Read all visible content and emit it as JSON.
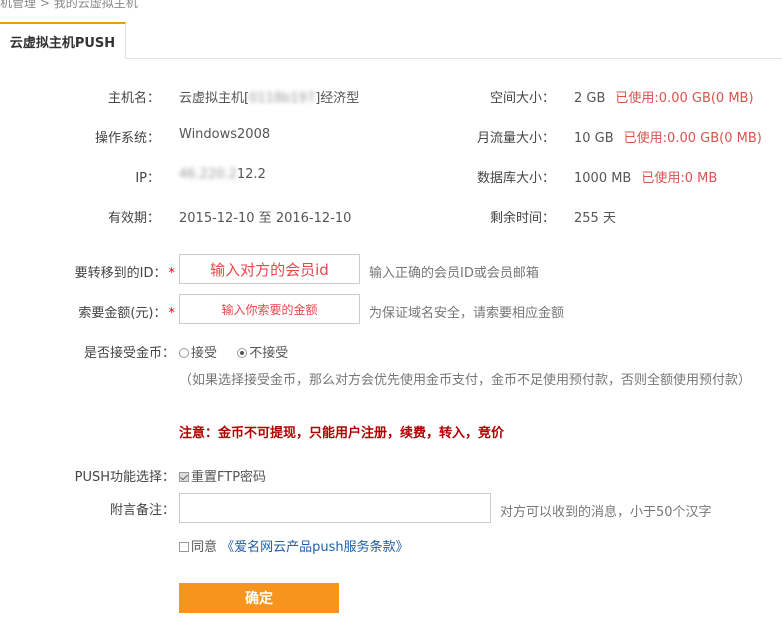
{
  "breadcrumb": {
    "parent": "机管理",
    "separator": ">",
    "current": "我的云虚拟主机"
  },
  "tab": {
    "label": "云虚拟主机PUSH"
  },
  "info": {
    "host_name_label": "主机名：",
    "host_name_prefix": "云虚拟主机[",
    "host_name_masked": "0118b197",
    "host_name_suffix": "]经济型",
    "os_label": "操作系统：",
    "os_value": "Windows2008",
    "ip_label": "IP：",
    "ip_masked": "46.220.2",
    "ip_suffix": "12.2",
    "validity_label": "有效期：",
    "validity_value": "2015-12-10 至 2016-12-10",
    "space_label": "空间大小：",
    "space_value": "2 GB",
    "space_used": "已使用:0.00 GB(0 MB)",
    "traffic_label": "月流量大小：",
    "traffic_value": "10 GB",
    "traffic_used": "已使用:0.00 GB(0 MB)",
    "db_label": "数据库大小：",
    "db_value": "1000 MB",
    "db_used": "已使用:0 MB",
    "remaining_label": "剩余时间：",
    "remaining_value": "255 天"
  },
  "form": {
    "target_id_label": "要转移到的ID：",
    "target_id_annotation": "输入对方的会员id",
    "target_id_hint": "输入正确的会员ID或会员邮箱",
    "amount_label": "索要金额(元)：",
    "amount_annotation": "输入你索要的金额",
    "amount_hint": "为保证域名安全，请索要相应金额",
    "required_mark": "*",
    "gold_label": "是否接受金币：",
    "gold_accept": "接受",
    "gold_reject": "不接受",
    "gold_note": "（如果选择接受金币，那么对方会优先使用金币支付，金币不足使用预付款，否则全额使用预付款）",
    "gold_warning": "注意：金币不可提现，只能用户注册，续费，转入，竞价",
    "push_func_label": "PUSH功能选择：",
    "push_func_option": "重置FTP密码",
    "remark_label": "附言备注：",
    "remark_value": "",
    "remark_hint": "对方可以收到的消息，小于50个汉字",
    "agree_label": "同意",
    "terms_link": "《爱名网云产品push服务条款》",
    "submit_label": "确定"
  },
  "colors": {
    "accent": "#f7941d",
    "used": "#d9534f",
    "warning": "#b00000",
    "link": "#1f5fa8"
  }
}
